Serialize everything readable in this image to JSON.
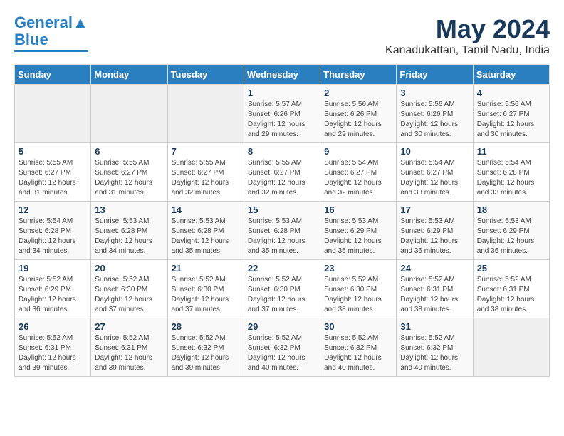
{
  "logo": {
    "line1": "General",
    "line2": "Blue"
  },
  "title": "May 2024",
  "subtitle": "Kanadukattan, Tamil Nadu, India",
  "weekdays": [
    "Sunday",
    "Monday",
    "Tuesday",
    "Wednesday",
    "Thursday",
    "Friday",
    "Saturday"
  ],
  "weeks": [
    [
      {
        "day": "",
        "info": ""
      },
      {
        "day": "",
        "info": ""
      },
      {
        "day": "",
        "info": ""
      },
      {
        "day": "1",
        "info": "Sunrise: 5:57 AM\nSunset: 6:26 PM\nDaylight: 12 hours and 29 minutes."
      },
      {
        "day": "2",
        "info": "Sunrise: 5:56 AM\nSunset: 6:26 PM\nDaylight: 12 hours and 29 minutes."
      },
      {
        "day": "3",
        "info": "Sunrise: 5:56 AM\nSunset: 6:26 PM\nDaylight: 12 hours and 30 minutes."
      },
      {
        "day": "4",
        "info": "Sunrise: 5:56 AM\nSunset: 6:27 PM\nDaylight: 12 hours and 30 minutes."
      }
    ],
    [
      {
        "day": "5",
        "info": "Sunrise: 5:55 AM\nSunset: 6:27 PM\nDaylight: 12 hours and 31 minutes."
      },
      {
        "day": "6",
        "info": "Sunrise: 5:55 AM\nSunset: 6:27 PM\nDaylight: 12 hours and 31 minutes."
      },
      {
        "day": "7",
        "info": "Sunrise: 5:55 AM\nSunset: 6:27 PM\nDaylight: 12 hours and 32 minutes."
      },
      {
        "day": "8",
        "info": "Sunrise: 5:55 AM\nSunset: 6:27 PM\nDaylight: 12 hours and 32 minutes."
      },
      {
        "day": "9",
        "info": "Sunrise: 5:54 AM\nSunset: 6:27 PM\nDaylight: 12 hours and 32 minutes."
      },
      {
        "day": "10",
        "info": "Sunrise: 5:54 AM\nSunset: 6:27 PM\nDaylight: 12 hours and 33 minutes."
      },
      {
        "day": "11",
        "info": "Sunrise: 5:54 AM\nSunset: 6:28 PM\nDaylight: 12 hours and 33 minutes."
      }
    ],
    [
      {
        "day": "12",
        "info": "Sunrise: 5:54 AM\nSunset: 6:28 PM\nDaylight: 12 hours and 34 minutes."
      },
      {
        "day": "13",
        "info": "Sunrise: 5:53 AM\nSunset: 6:28 PM\nDaylight: 12 hours and 34 minutes."
      },
      {
        "day": "14",
        "info": "Sunrise: 5:53 AM\nSunset: 6:28 PM\nDaylight: 12 hours and 35 minutes."
      },
      {
        "day": "15",
        "info": "Sunrise: 5:53 AM\nSunset: 6:28 PM\nDaylight: 12 hours and 35 minutes."
      },
      {
        "day": "16",
        "info": "Sunrise: 5:53 AM\nSunset: 6:29 PM\nDaylight: 12 hours and 35 minutes."
      },
      {
        "day": "17",
        "info": "Sunrise: 5:53 AM\nSunset: 6:29 PM\nDaylight: 12 hours and 36 minutes."
      },
      {
        "day": "18",
        "info": "Sunrise: 5:53 AM\nSunset: 6:29 PM\nDaylight: 12 hours and 36 minutes."
      }
    ],
    [
      {
        "day": "19",
        "info": "Sunrise: 5:52 AM\nSunset: 6:29 PM\nDaylight: 12 hours and 36 minutes."
      },
      {
        "day": "20",
        "info": "Sunrise: 5:52 AM\nSunset: 6:30 PM\nDaylight: 12 hours and 37 minutes."
      },
      {
        "day": "21",
        "info": "Sunrise: 5:52 AM\nSunset: 6:30 PM\nDaylight: 12 hours and 37 minutes."
      },
      {
        "day": "22",
        "info": "Sunrise: 5:52 AM\nSunset: 6:30 PM\nDaylight: 12 hours and 37 minutes."
      },
      {
        "day": "23",
        "info": "Sunrise: 5:52 AM\nSunset: 6:30 PM\nDaylight: 12 hours and 38 minutes."
      },
      {
        "day": "24",
        "info": "Sunrise: 5:52 AM\nSunset: 6:31 PM\nDaylight: 12 hours and 38 minutes."
      },
      {
        "day": "25",
        "info": "Sunrise: 5:52 AM\nSunset: 6:31 PM\nDaylight: 12 hours and 38 minutes."
      }
    ],
    [
      {
        "day": "26",
        "info": "Sunrise: 5:52 AM\nSunset: 6:31 PM\nDaylight: 12 hours and 39 minutes."
      },
      {
        "day": "27",
        "info": "Sunrise: 5:52 AM\nSunset: 6:31 PM\nDaylight: 12 hours and 39 minutes."
      },
      {
        "day": "28",
        "info": "Sunrise: 5:52 AM\nSunset: 6:32 PM\nDaylight: 12 hours and 39 minutes."
      },
      {
        "day": "29",
        "info": "Sunrise: 5:52 AM\nSunset: 6:32 PM\nDaylight: 12 hours and 40 minutes."
      },
      {
        "day": "30",
        "info": "Sunrise: 5:52 AM\nSunset: 6:32 PM\nDaylight: 12 hours and 40 minutes."
      },
      {
        "day": "31",
        "info": "Sunrise: 5:52 AM\nSunset: 6:32 PM\nDaylight: 12 hours and 40 minutes."
      },
      {
        "day": "",
        "info": ""
      }
    ]
  ]
}
